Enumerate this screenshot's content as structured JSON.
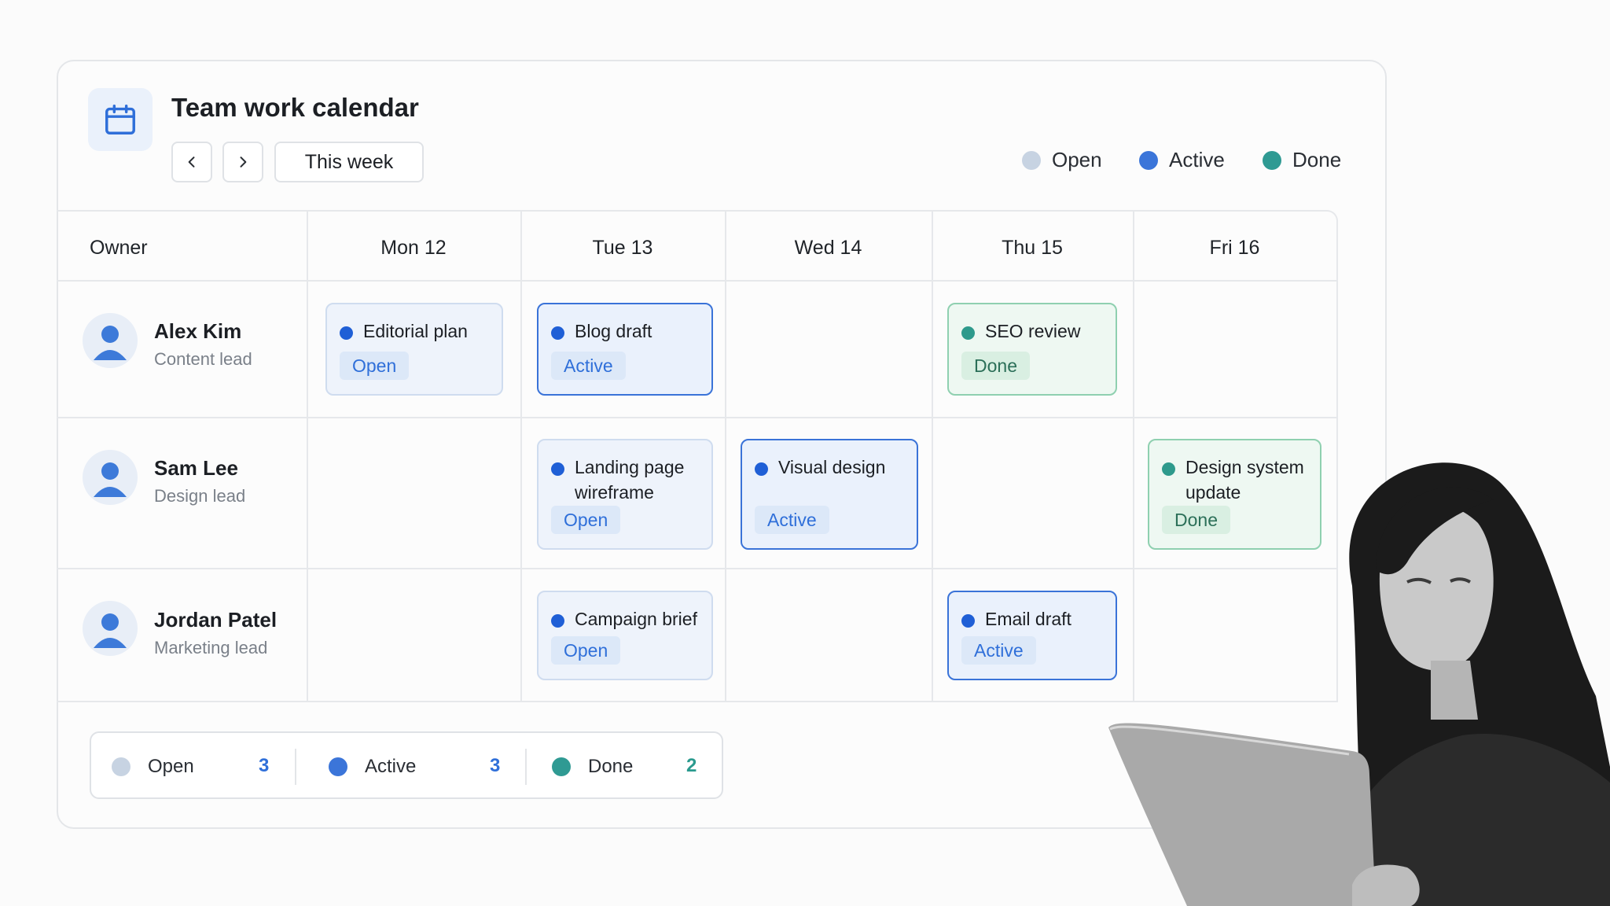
{
  "header": {
    "title": "Team work calendar",
    "prev_icon": "chevron-left-icon",
    "next_icon": "chevron-right-icon",
    "week_label": "This week",
    "app_icon": "calendar-icon"
  },
  "legend": [
    {
      "label": "Open",
      "color": "#c7d3e2"
    },
    {
      "label": "Active",
      "color": "#3b75d9"
    },
    {
      "label": "Done",
      "color": "#2f9a93"
    }
  ],
  "table": {
    "owner_header": "Owner",
    "days": [
      "Mon 12",
      "Tue 13",
      "Wed 14",
      "Thu 15",
      "Fri 16"
    ],
    "people": [
      {
        "name": "Alex Kim",
        "role": "Content lead"
      },
      {
        "name": "Sam Lee",
        "role": "Design lead"
      },
      {
        "name": "Jordan Patel",
        "role": "Marketing lead"
      }
    ],
    "tasks": [
      {
        "title": "Editorial plan",
        "status": "Open",
        "person": "Alex Kim",
        "day": "Mon 12"
      },
      {
        "title": "Blog draft",
        "status": "Active",
        "person": "Alex Kim",
        "day": "Tue 13"
      },
      {
        "title": "SEO review",
        "status": "Done",
        "person": "Alex Kim",
        "day": "Thu 15"
      },
      {
        "title": "Landing page wireframe",
        "status": "Open",
        "person": "Sam Lee",
        "day": "Tue 13"
      },
      {
        "title": "Visual design",
        "status": "Active",
        "person": "Sam Lee",
        "day": "Wed 14"
      },
      {
        "title": "Design system update",
        "status": "Done",
        "person": "Sam Lee",
        "day": "Fri 16"
      },
      {
        "title": "Campaign brief",
        "status": "Open",
        "person": "Jordan Patel",
        "day": "Tue 13"
      },
      {
        "title": "Email draft",
        "status": "Active",
        "person": "Jordan Patel",
        "day": "Thu 15"
      }
    ]
  },
  "summary": [
    {
      "label": "Open",
      "count": "3",
      "color": "#c7d3e2"
    },
    {
      "label": "Active",
      "count": "3",
      "color": "#3b75d9"
    },
    {
      "label": "Done",
      "count": "2",
      "color": "#2f9a93"
    }
  ]
}
